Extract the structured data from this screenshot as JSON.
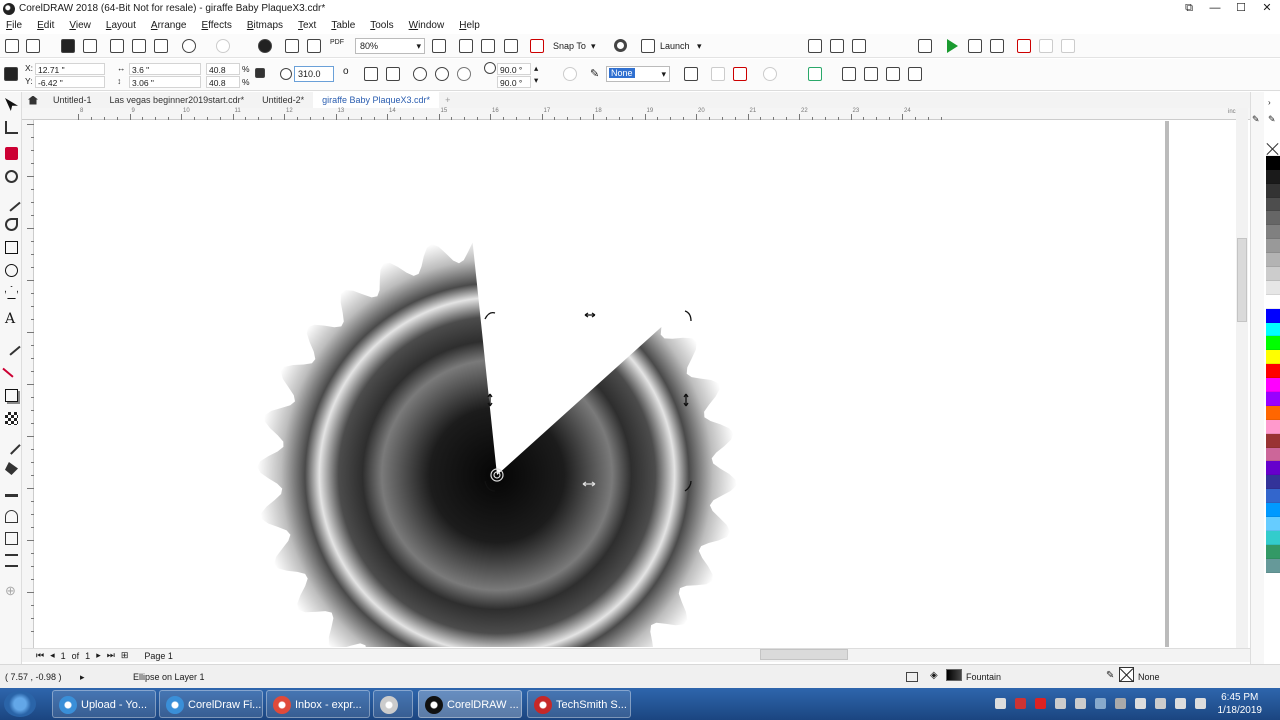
{
  "window": {
    "title": "CorelDRAW 2018 (64-Bit Not for resale) - giraffe Baby PlaqueX3.cdr*",
    "controls": [
      "⧉",
      "—",
      "☐",
      "✕"
    ]
  },
  "menu": [
    "File",
    "Edit",
    "View",
    "Layout",
    "Arrange",
    "Effects",
    "Bitmaps",
    "Text",
    "Table",
    "Tools",
    "Window",
    "Help"
  ],
  "toolbar": {
    "zoom": "80%",
    "snap_to": "Snap To",
    "launch": "Launch",
    "pdf": "PDF"
  },
  "property_bar": {
    "x": "12.71 \"",
    "y": "-6.42 \"",
    "width": "3.6 \"",
    "height": "3.06 \"",
    "scale_w": "40.8",
    "scale_h": "40.8",
    "pct": "%",
    "rotation": "310.0",
    "degree_symbol": "o",
    "start_angle": "90.0 °",
    "end_angle": "90.0 °",
    "outline": "None"
  },
  "tabs": [
    "Untitled-1",
    "Las vegas beginner2019start.cdr*",
    "Untitled-2*",
    "giraffe Baby PlaqueX3.cdr*"
  ],
  "active_tab": 3,
  "ruler": {
    "labels": [
      "8",
      "9",
      "10",
      "11",
      "12",
      "13",
      "14",
      "15",
      "16",
      "17",
      "18",
      "19",
      "20",
      "21",
      "22",
      "23",
      "24"
    ],
    "unit": "inches"
  },
  "page_nav": {
    "current": "1",
    "of_label": "of",
    "total": "1",
    "page_tab": "Page 1"
  },
  "status": {
    "coords": "( 7.57 , -0.98 )",
    "selection": "Ellipse on Layer 1",
    "fill": "Fountain",
    "outline": "None"
  },
  "palette": [
    "#000000",
    "#1a1a1a",
    "#333333",
    "#4d4d4d",
    "#666666",
    "#808080",
    "#999999",
    "#b3b3b3",
    "#cccccc",
    "#e6e6e6",
    "#ffffff",
    "#0000ff",
    "#00ffff",
    "#00ff00",
    "#ffff00",
    "#ff0000",
    "#ff00ff",
    "#9900ff",
    "#ff6600",
    "#ff99cc",
    "#993333",
    "#cc6699",
    "#6600cc",
    "#333399",
    "#3366cc",
    "#0099ff",
    "#66ccff",
    "#33cccc",
    "#339966",
    "#669999"
  ],
  "taskbar": {
    "tasks": [
      {
        "label": "Upload - Yo...",
        "icon": "#3a8fd8"
      },
      {
        "label": "CorelDraw Fi...",
        "icon": "#3a8fd8"
      },
      {
        "label": "Inbox - expr...",
        "icon": "#e04a3a"
      },
      {
        "label": "",
        "icon": "#cccccc"
      },
      {
        "label": "CorelDRAW ...",
        "icon": "#111111"
      },
      {
        "label": "TechSmith S...",
        "icon": "#c62828"
      }
    ],
    "time": "6:45 PM",
    "date": "1/18/2019"
  }
}
